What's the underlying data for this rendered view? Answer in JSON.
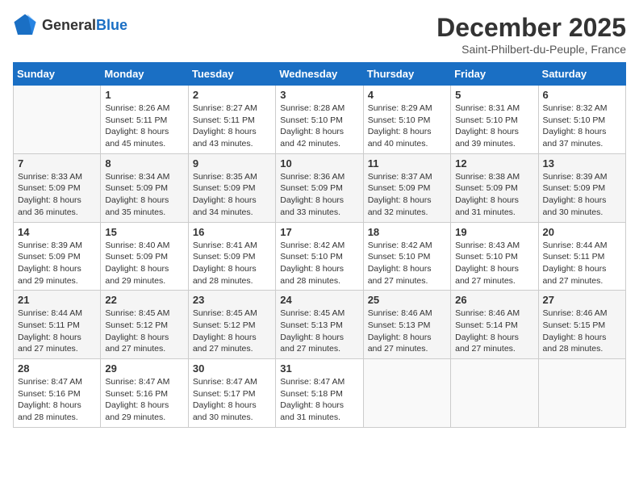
{
  "header": {
    "logo_general": "General",
    "logo_blue": "Blue",
    "month_title": "December 2025",
    "location": "Saint-Philbert-du-Peuple, France"
  },
  "days_of_week": [
    "Sunday",
    "Monday",
    "Tuesday",
    "Wednesday",
    "Thursday",
    "Friday",
    "Saturday"
  ],
  "weeks": [
    [
      {
        "day": "",
        "info": ""
      },
      {
        "day": "1",
        "info": "Sunrise: 8:26 AM\nSunset: 5:11 PM\nDaylight: 8 hours\nand 45 minutes."
      },
      {
        "day": "2",
        "info": "Sunrise: 8:27 AM\nSunset: 5:11 PM\nDaylight: 8 hours\nand 43 minutes."
      },
      {
        "day": "3",
        "info": "Sunrise: 8:28 AM\nSunset: 5:10 PM\nDaylight: 8 hours\nand 42 minutes."
      },
      {
        "day": "4",
        "info": "Sunrise: 8:29 AM\nSunset: 5:10 PM\nDaylight: 8 hours\nand 40 minutes."
      },
      {
        "day": "5",
        "info": "Sunrise: 8:31 AM\nSunset: 5:10 PM\nDaylight: 8 hours\nand 39 minutes."
      },
      {
        "day": "6",
        "info": "Sunrise: 8:32 AM\nSunset: 5:10 PM\nDaylight: 8 hours\nand 37 minutes."
      }
    ],
    [
      {
        "day": "7",
        "info": "Sunrise: 8:33 AM\nSunset: 5:09 PM\nDaylight: 8 hours\nand 36 minutes."
      },
      {
        "day": "8",
        "info": "Sunrise: 8:34 AM\nSunset: 5:09 PM\nDaylight: 8 hours\nand 35 minutes."
      },
      {
        "day": "9",
        "info": "Sunrise: 8:35 AM\nSunset: 5:09 PM\nDaylight: 8 hours\nand 34 minutes."
      },
      {
        "day": "10",
        "info": "Sunrise: 8:36 AM\nSunset: 5:09 PM\nDaylight: 8 hours\nand 33 minutes."
      },
      {
        "day": "11",
        "info": "Sunrise: 8:37 AM\nSunset: 5:09 PM\nDaylight: 8 hours\nand 32 minutes."
      },
      {
        "day": "12",
        "info": "Sunrise: 8:38 AM\nSunset: 5:09 PM\nDaylight: 8 hours\nand 31 minutes."
      },
      {
        "day": "13",
        "info": "Sunrise: 8:39 AM\nSunset: 5:09 PM\nDaylight: 8 hours\nand 30 minutes."
      }
    ],
    [
      {
        "day": "14",
        "info": "Sunrise: 8:39 AM\nSunset: 5:09 PM\nDaylight: 8 hours\nand 29 minutes."
      },
      {
        "day": "15",
        "info": "Sunrise: 8:40 AM\nSunset: 5:09 PM\nDaylight: 8 hours\nand 29 minutes."
      },
      {
        "day": "16",
        "info": "Sunrise: 8:41 AM\nSunset: 5:09 PM\nDaylight: 8 hours\nand 28 minutes."
      },
      {
        "day": "17",
        "info": "Sunrise: 8:42 AM\nSunset: 5:10 PM\nDaylight: 8 hours\nand 28 minutes."
      },
      {
        "day": "18",
        "info": "Sunrise: 8:42 AM\nSunset: 5:10 PM\nDaylight: 8 hours\nand 27 minutes."
      },
      {
        "day": "19",
        "info": "Sunrise: 8:43 AM\nSunset: 5:10 PM\nDaylight: 8 hours\nand 27 minutes."
      },
      {
        "day": "20",
        "info": "Sunrise: 8:44 AM\nSunset: 5:11 PM\nDaylight: 8 hours\nand 27 minutes."
      }
    ],
    [
      {
        "day": "21",
        "info": "Sunrise: 8:44 AM\nSunset: 5:11 PM\nDaylight: 8 hours\nand 27 minutes."
      },
      {
        "day": "22",
        "info": "Sunrise: 8:45 AM\nSunset: 5:12 PM\nDaylight: 8 hours\nand 27 minutes."
      },
      {
        "day": "23",
        "info": "Sunrise: 8:45 AM\nSunset: 5:12 PM\nDaylight: 8 hours\nand 27 minutes."
      },
      {
        "day": "24",
        "info": "Sunrise: 8:45 AM\nSunset: 5:13 PM\nDaylight: 8 hours\nand 27 minutes."
      },
      {
        "day": "25",
        "info": "Sunrise: 8:46 AM\nSunset: 5:13 PM\nDaylight: 8 hours\nand 27 minutes."
      },
      {
        "day": "26",
        "info": "Sunrise: 8:46 AM\nSunset: 5:14 PM\nDaylight: 8 hours\nand 27 minutes."
      },
      {
        "day": "27",
        "info": "Sunrise: 8:46 AM\nSunset: 5:15 PM\nDaylight: 8 hours\nand 28 minutes."
      }
    ],
    [
      {
        "day": "28",
        "info": "Sunrise: 8:47 AM\nSunset: 5:16 PM\nDaylight: 8 hours\nand 28 minutes."
      },
      {
        "day": "29",
        "info": "Sunrise: 8:47 AM\nSunset: 5:16 PM\nDaylight: 8 hours\nand 29 minutes."
      },
      {
        "day": "30",
        "info": "Sunrise: 8:47 AM\nSunset: 5:17 PM\nDaylight: 8 hours\nand 30 minutes."
      },
      {
        "day": "31",
        "info": "Sunrise: 8:47 AM\nSunset: 5:18 PM\nDaylight: 8 hours\nand 31 minutes."
      },
      {
        "day": "",
        "info": ""
      },
      {
        "day": "",
        "info": ""
      },
      {
        "day": "",
        "info": ""
      }
    ]
  ]
}
